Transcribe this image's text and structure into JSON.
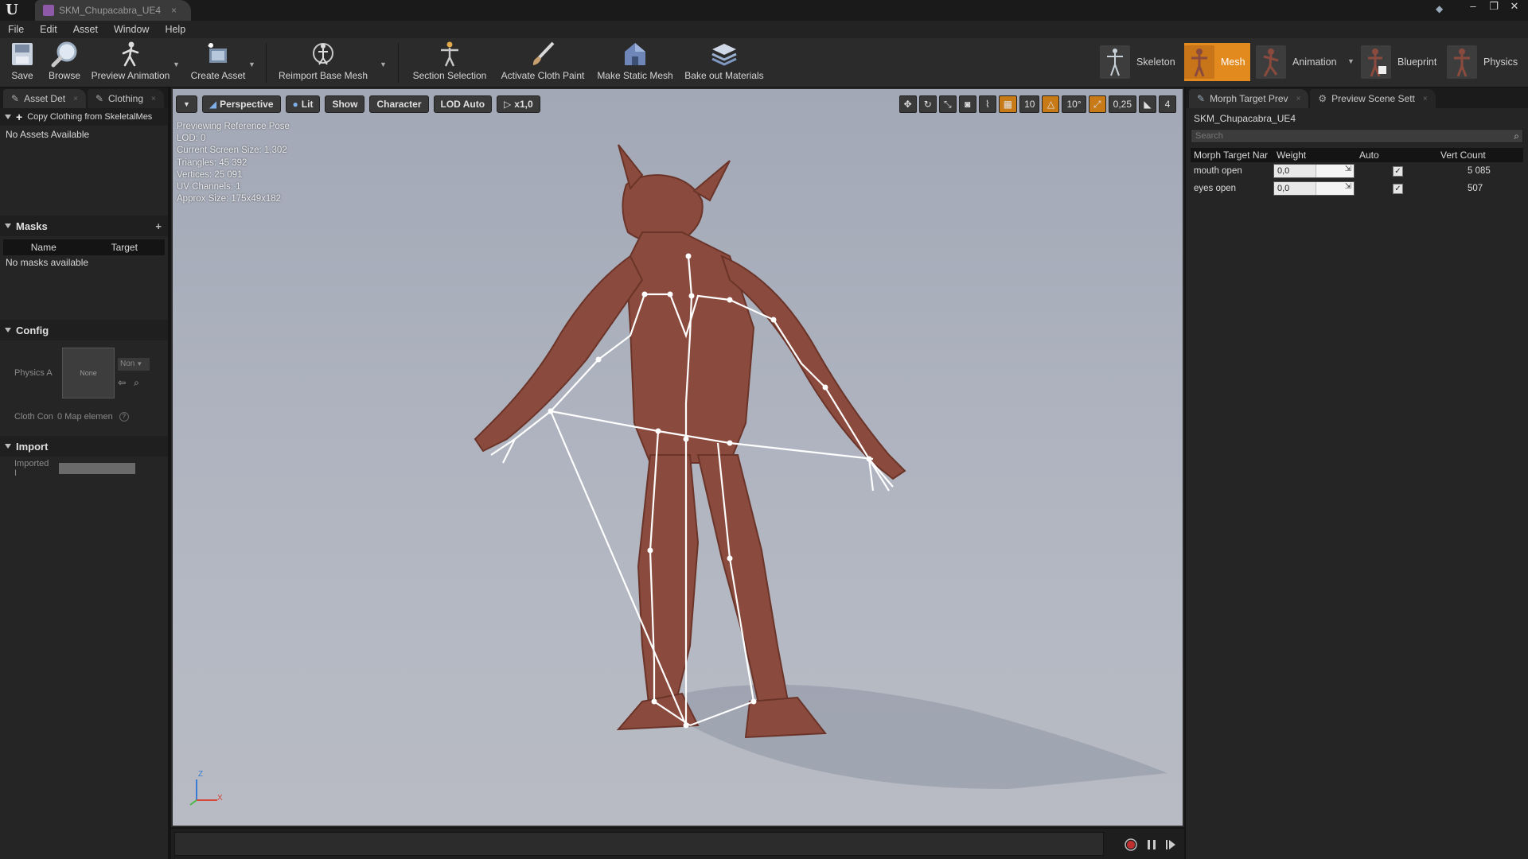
{
  "window": {
    "tab_title": "SKM_Chupacabra_UE4",
    "logo": "U",
    "min": "–",
    "max": "❐",
    "close": "✕"
  },
  "menu": [
    "File",
    "Edit",
    "Asset",
    "Window",
    "Help"
  ],
  "toolbar": {
    "save": "Save",
    "browse": "Browse",
    "preview_animation": "Preview Animation",
    "create_asset": "Create Asset",
    "reimport_base_mesh": "Reimport Base Mesh",
    "section_selection": "Section Selection",
    "activate_cloth_paint": "Activate Cloth Paint",
    "make_static_mesh": "Make Static Mesh",
    "bake_out_materials": "Bake out Materials"
  },
  "modes": {
    "skeleton": "Skeleton",
    "mesh": "Mesh",
    "animation": "Animation",
    "blueprint": "Blueprint",
    "physics": "Physics"
  },
  "left_panel": {
    "tabs": [
      "Asset Det",
      "Clothing"
    ],
    "copy_clothing": "Copy Clothing from SkeletalMes",
    "no_assets": "No Assets Available",
    "masks": {
      "title": "Masks",
      "col_name": "Name",
      "col_target": "Target",
      "empty": "No masks available"
    },
    "config": {
      "title": "Config",
      "physics_label": "Physics A",
      "thumb_label": "None",
      "dropdown": "Non",
      "cloth_label": "Cloth Con",
      "map_elements": "0 Map elemen"
    },
    "import": {
      "title": "Import",
      "imported_label": "Imported I"
    }
  },
  "viewport": {
    "perspective": "Perspective",
    "lit": "Lit",
    "show": "Show",
    "character": "Character",
    "lod": "LOD Auto",
    "speed": "x1,0",
    "grid_snap": "10",
    "rot_snap": "10°",
    "scale_snap": "0,25",
    "cam_speed": "4",
    "stats": [
      "Previewing Reference Pose",
      "LOD: 0",
      "Current Screen Size: 1,302",
      "Triangles: 45 392",
      "Vertices: 25 091",
      "UV Channels: 1",
      "Approx Size: 175x49x182"
    ],
    "axis_z": "Z",
    "axis_x": "X"
  },
  "right_panel": {
    "tabs": [
      "Morph Target Prev",
      "Preview Scene Sett"
    ],
    "asset_name": "SKM_Chupacabra_UE4",
    "search_placeholder": "Search",
    "columns": [
      "Morph Target Nar",
      "Weight",
      "Auto",
      "Vert Count"
    ],
    "rows": [
      {
        "name": "mouth open",
        "weight": "0,0",
        "auto": true,
        "verts": "5 085"
      },
      {
        "name": "eyes open",
        "weight": "0,0",
        "auto": true,
        "verts": "507"
      }
    ]
  },
  "colors": {
    "accent": "#e38a1e",
    "creature": "#8a4a3e",
    "viewport_bg": "#aeb3bf"
  }
}
